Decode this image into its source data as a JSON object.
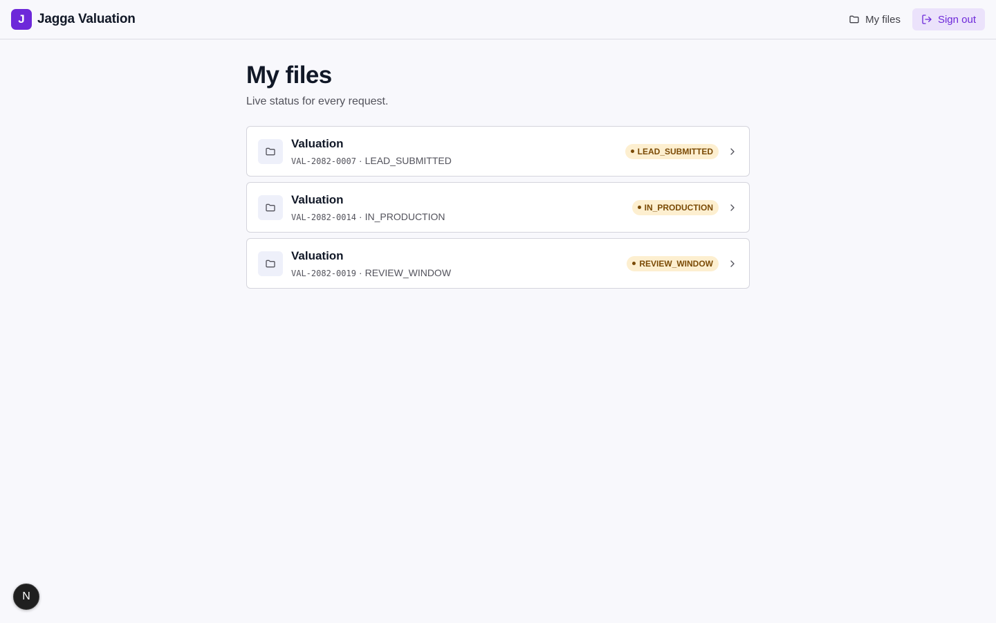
{
  "header": {
    "logo_letter": "J",
    "brand_name": "Jagga Valuation",
    "nav_my_files": "My files",
    "sign_out": "Sign out"
  },
  "page": {
    "title": "My files",
    "subtitle": "Live status for every request."
  },
  "files": [
    {
      "title": "Valuation",
      "code": "VAL-2082-0007",
      "separator": "·",
      "status": "LEAD_SUBMITTED",
      "badge": "LEAD_SUBMITTED"
    },
    {
      "title": "Valuation",
      "code": "VAL-2082-0014",
      "separator": "·",
      "status": "IN_PRODUCTION",
      "badge": "IN_PRODUCTION"
    },
    {
      "title": "Valuation",
      "code": "VAL-2082-0019",
      "separator": "·",
      "status": "REVIEW_WINDOW",
      "badge": "REVIEW_WINDOW"
    }
  ],
  "fab": {
    "letter": "N"
  },
  "icons": {
    "folder": "folder-icon",
    "sign_out": "log-out-icon",
    "chevron": "chevron-right-icon"
  },
  "colors": {
    "brand": "#6d28d9",
    "badge_bg": "#fdefd0",
    "badge_text": "#7a4a05",
    "signout_bg": "#ebe2fb"
  }
}
